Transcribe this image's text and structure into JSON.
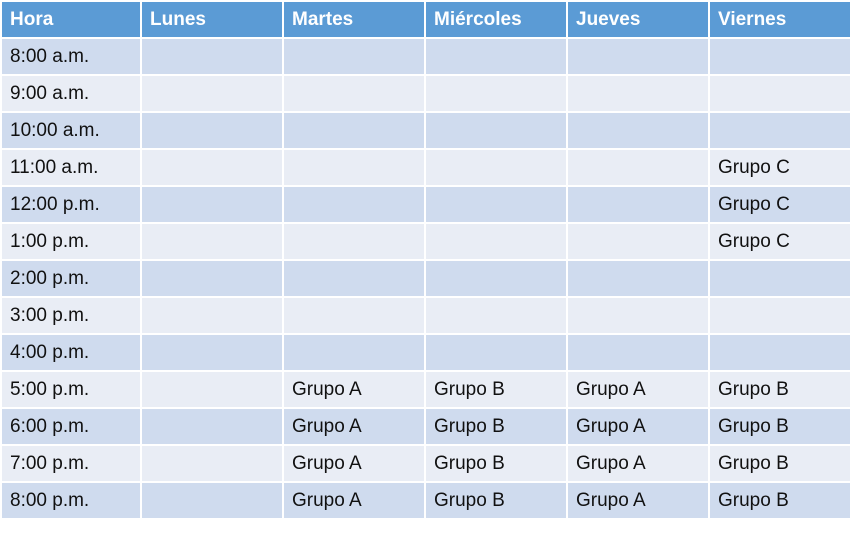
{
  "headers": [
    "Hora",
    "Lunes",
    "Martes",
    "Miércoles",
    "Jueves",
    "Viernes"
  ],
  "rows": [
    {
      "time": "8:00 a.m.",
      "cells": [
        "",
        "",
        "",
        "",
        ""
      ]
    },
    {
      "time": "9:00 a.m.",
      "cells": [
        "",
        "",
        "",
        "",
        ""
      ]
    },
    {
      "time": "10:00 a.m.",
      "cells": [
        "",
        "",
        "",
        "",
        ""
      ]
    },
    {
      "time": "11:00 a.m.",
      "cells": [
        "",
        "",
        "",
        "",
        "Grupo C"
      ]
    },
    {
      "time": "12:00 p.m.",
      "cells": [
        "",
        "",
        "",
        "",
        "Grupo C"
      ]
    },
    {
      "time": "1:00 p.m.",
      "cells": [
        "",
        "",
        "",
        "",
        "Grupo C"
      ]
    },
    {
      "time": "2:00 p.m.",
      "cells": [
        "",
        "",
        "",
        "",
        ""
      ]
    },
    {
      "time": "3:00 p.m.",
      "cells": [
        "",
        "",
        "",
        "",
        ""
      ]
    },
    {
      "time": "4:00 p.m.",
      "cells": [
        "",
        "",
        "",
        "",
        ""
      ]
    },
    {
      "time": "5:00 p.m.",
      "cells": [
        "",
        "Grupo A",
        "Grupo B",
        "Grupo A",
        "Grupo B"
      ]
    },
    {
      "time": "6:00 p.m.",
      "cells": [
        "",
        "Grupo A",
        "Grupo B",
        "Grupo A",
        "Grupo B"
      ]
    },
    {
      "time": "7:00 p.m.",
      "cells": [
        "",
        "Grupo A",
        "Grupo B",
        "Grupo A",
        "Grupo B"
      ]
    },
    {
      "time": "8:00 p.m.",
      "cells": [
        "",
        "Grupo A",
        "Grupo B",
        "Grupo A",
        "Grupo B"
      ]
    }
  ],
  "colors": {
    "header": "#5b9bd5",
    "row_dark": "#cfdbee",
    "row_light": "#e9edf5"
  }
}
